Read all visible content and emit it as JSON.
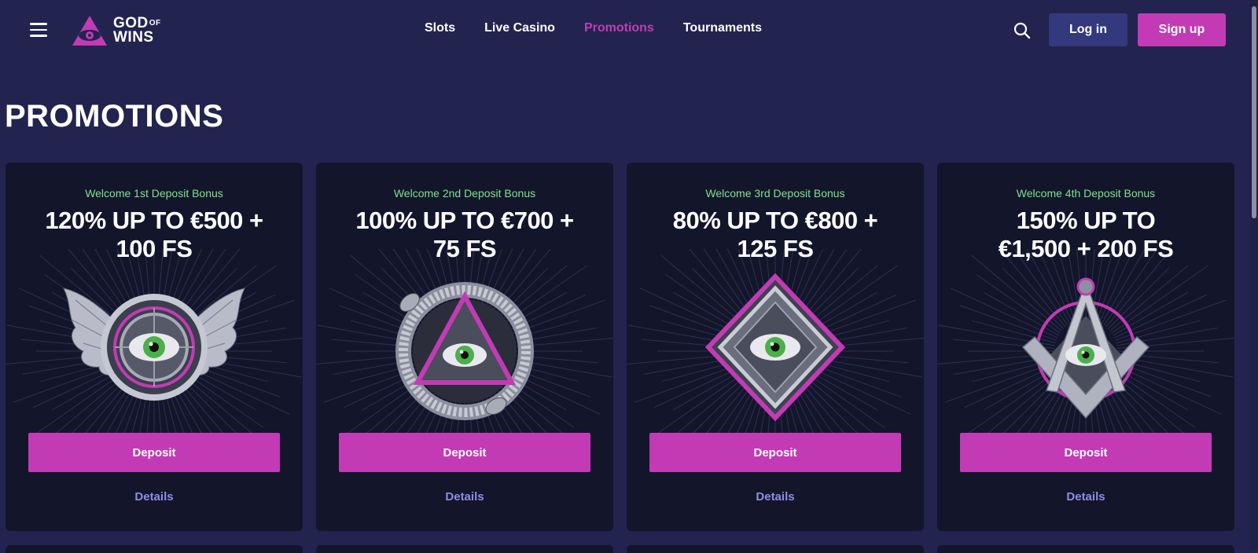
{
  "header": {
    "logo": {
      "line1": "GOD",
      "of": "OF",
      "line2": "WINS"
    },
    "nav": [
      {
        "label": "Slots",
        "active": false
      },
      {
        "label": "Live Casino",
        "active": false
      },
      {
        "label": "Promotions",
        "active": true
      },
      {
        "label": "Tournaments",
        "active": false
      }
    ],
    "login_label": "Log in",
    "signup_label": "Sign up"
  },
  "page": {
    "title": "PROMOTIONS"
  },
  "promotions": [
    {
      "subtitle": "Welcome 1st Deposit Bonus",
      "title_line1": "120% UP TO €500 +",
      "title_line2": "100 FS",
      "image": "winged-eye-emblem",
      "deposit_label": "Deposit",
      "details_label": "Details"
    },
    {
      "subtitle": "Welcome 2nd Deposit Bonus",
      "title_line1": "100% UP TO €700 +",
      "title_line2": "75 FS",
      "image": "serpent-triangle-eye-emblem",
      "deposit_label": "Deposit",
      "details_label": "Details"
    },
    {
      "subtitle": "Welcome 3rd Deposit Bonus",
      "title_line1": "80% UP TO €800 +",
      "title_line2": "125 FS",
      "image": "diamond-eye-emblem",
      "deposit_label": "Deposit",
      "details_label": "Details"
    },
    {
      "subtitle": "Welcome 4th Deposit Bonus",
      "title_line1": "150% UP TO",
      "title_line2": "€1,500 + 200 FS",
      "image": "compass-square-eye-emblem",
      "deposit_label": "Deposit",
      "details_label": "Details"
    }
  ],
  "colors": {
    "background": "#22244f",
    "card": "#13152b",
    "accent": "#c23bb5",
    "subtitle_green": "#7de38a",
    "login_button": "#34397d",
    "details_link": "#8a8fe0"
  }
}
